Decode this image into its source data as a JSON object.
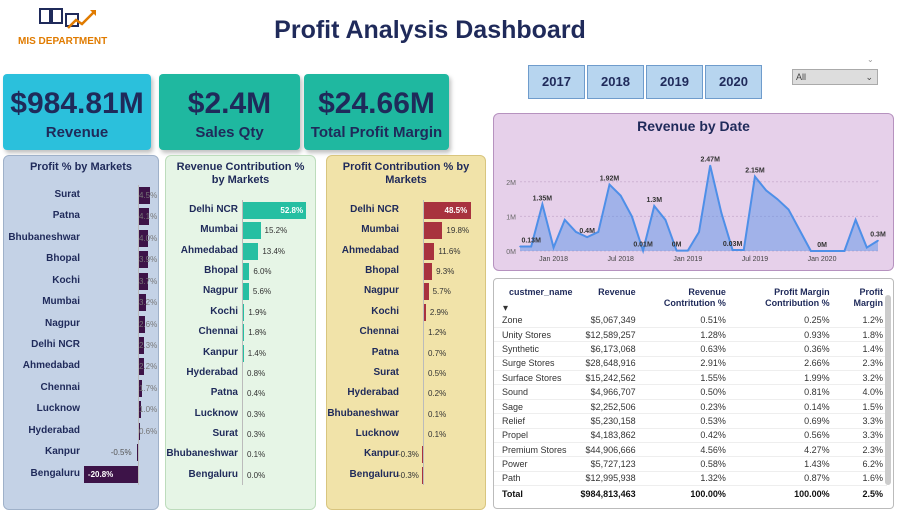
{
  "header": {
    "title": "Profit Analysis Dashboard",
    "logo_text": "MIS DEPARTMENT"
  },
  "kpis": [
    {
      "value": "$984.81M",
      "label": "Revenue"
    },
    {
      "value": "$2.4M",
      "label": "Sales Qty"
    },
    {
      "value": "$24.66M",
      "label": "Total Profit Margin"
    }
  ],
  "filters": {
    "years": [
      "2017",
      "2018",
      "2019",
      "2020"
    ],
    "dropdown_value": "All"
  },
  "colors": {
    "profit_bar": "#3d1348",
    "revenue_contrib_bar": "#26bfa2",
    "profit_contrib_bar": "#a8323e",
    "revenue_line": "#4e8fe8"
  },
  "chart_data": [
    {
      "type": "bar",
      "title": "Profit % by Markets",
      "categories": [
        "Surat",
        "Patna",
        "Bhubaneshwar",
        "Bhopal",
        "Kochi",
        "Mumbai",
        "Nagpur",
        "Delhi NCR",
        "Ahmedabad",
        "Chennai",
        "Lucknow",
        "Hyderabad",
        "Kanpur",
        "Bengaluru"
      ],
      "values": [
        4.5,
        4.1,
        4.0,
        3.9,
        3.7,
        3.2,
        2.6,
        2.3,
        2.2,
        1.7,
        1.0,
        0.6,
        -0.5,
        -20.8
      ],
      "labels": [
        "4.5%",
        "4.1%",
        "4.0%",
        "3.9%",
        "3.7%",
        "3.2%",
        "2.6%",
        "2.3%",
        "2.2%",
        "1.7%",
        "1.0%",
        "0.6%",
        "-0.5%",
        "-20.8%"
      ]
    },
    {
      "type": "bar",
      "title": "Revenue Contribution % by Markets",
      "categories": [
        "Delhi NCR",
        "Mumbai",
        "Ahmedabad",
        "Bhopal",
        "Nagpur",
        "Kochi",
        "Chennai",
        "Kanpur",
        "Hyderabad",
        "Patna",
        "Lucknow",
        "Surat",
        "Bhubaneshwar",
        "Bengaluru"
      ],
      "values": [
        52.8,
        15.2,
        13.4,
        6.0,
        5.6,
        1.9,
        1.8,
        1.4,
        0.8,
        0.4,
        0.3,
        0.3,
        0.1,
        0.0
      ],
      "labels": [
        "52.8%",
        "15.2%",
        "13.4%",
        "6.0%",
        "5.6%",
        "1.9%",
        "1.8%",
        "1.4%",
        "0.8%",
        "0.4%",
        "0.3%",
        "0.3%",
        "0.1%",
        "0.0%"
      ]
    },
    {
      "type": "bar",
      "title": "Profit Contribution % by Markets",
      "categories": [
        "Delhi NCR",
        "Mumbai",
        "Ahmedabad",
        "Bhopal",
        "Nagpur",
        "Kochi",
        "Chennai",
        "Patna",
        "Surat",
        "Hyderabad",
        "Bhubaneshwar",
        "Lucknow",
        "Kanpur",
        "Bengaluru"
      ],
      "values": [
        48.5,
        19.8,
        11.6,
        9.3,
        5.7,
        2.9,
        1.2,
        0.7,
        0.5,
        0.2,
        0.1,
        0.1,
        -0.3,
        -0.3
      ],
      "labels": [
        "48.5%",
        "19.8%",
        "11.6%",
        "9.3%",
        "5.7%",
        "2.9%",
        "1.2%",
        "0.7%",
        "0.5%",
        "0.2%",
        "0.1%",
        "0.1%",
        "-0.3%",
        "-0.3%"
      ]
    },
    {
      "type": "area",
      "title": "Revenue by Date",
      "x": [
        "2017-10",
        "2017-11",
        "2017-12",
        "2018-01",
        "2018-02",
        "2018-03",
        "2018-04",
        "2018-05",
        "2018-06",
        "2018-07",
        "2018-08",
        "2018-09",
        "2018-10",
        "2018-11",
        "2018-12",
        "2019-01",
        "2019-02",
        "2019-03",
        "2019-04",
        "2019-05",
        "2019-06",
        "2019-07",
        "2019-08",
        "2019-09",
        "2019-10",
        "2019-11",
        "2019-12",
        "2020-01",
        "2020-02",
        "2020-03",
        "2020-04",
        "2020-05",
        "2020-06"
      ],
      "y": [
        0.13,
        0.13,
        1.35,
        0.1,
        0.9,
        0.55,
        0.4,
        0.55,
        1.92,
        1.6,
        1.0,
        0.01,
        1.3,
        0.9,
        0.01,
        0.01,
        0.55,
        2.47,
        1.1,
        0.03,
        0.03,
        2.15,
        1.75,
        1.5,
        1.2,
        0.6,
        0.0,
        0.0,
        0.0,
        0.0,
        0.9,
        0.1,
        0.3
      ],
      "point_labels": [
        {
          "i": 1,
          "text": "0.13M"
        },
        {
          "i": 2,
          "text": "1.35M"
        },
        {
          "i": 6,
          "text": "0.4M"
        },
        {
          "i": 8,
          "text": "1.92M"
        },
        {
          "i": 11,
          "text": "0.01M"
        },
        {
          "i": 12,
          "text": "1.3M"
        },
        {
          "i": 14,
          "text": "0M"
        },
        {
          "i": 17,
          "text": "2.47M"
        },
        {
          "i": 19,
          "text": "0.03M"
        },
        {
          "i": 21,
          "text": "2.15M"
        },
        {
          "i": 27,
          "text": "0M"
        },
        {
          "i": 32,
          "text": "0.3M"
        }
      ],
      "yticks": [
        "0M",
        "1M",
        "2M"
      ],
      "xticks": [
        {
          "i": 3,
          "label": "Jan 2018"
        },
        {
          "i": 9,
          "label": "Jul 2018"
        },
        {
          "i": 15,
          "label": "Jan 2019"
        },
        {
          "i": 21,
          "label": "Jul 2019"
        },
        {
          "i": 27,
          "label": "Jan 2020"
        }
      ],
      "ylim": [
        0,
        2.6
      ]
    }
  ],
  "table": {
    "columns": [
      "custmer_name",
      "Revenue",
      "Revenue Contritution %",
      "Profit Margin Contribution %",
      "Profit Margin"
    ],
    "rows": [
      [
        "Zone",
        "$5,067,349",
        "0.51%",
        "0.25%",
        "1.2%"
      ],
      [
        "Unity Stores",
        "$12,589,257",
        "1.28%",
        "0.93%",
        "1.8%"
      ],
      [
        "Synthetic",
        "$6,173,068",
        "0.63%",
        "0.36%",
        "1.4%"
      ],
      [
        "Surge Stores",
        "$28,648,916",
        "2.91%",
        "2.66%",
        "2.3%"
      ],
      [
        "Surface Stores",
        "$15,242,562",
        "1.55%",
        "1.99%",
        "3.2%"
      ],
      [
        "Sound",
        "$4,966,707",
        "0.50%",
        "0.81%",
        "4.0%"
      ],
      [
        "Sage",
        "$2,252,506",
        "0.23%",
        "0.14%",
        "1.5%"
      ],
      [
        "Relief",
        "$5,230,158",
        "0.53%",
        "0.69%",
        "3.3%"
      ],
      [
        "Propel",
        "$4,183,862",
        "0.42%",
        "0.56%",
        "3.3%"
      ],
      [
        "Premium Stores",
        "$44,906,666",
        "4.56%",
        "4.27%",
        "2.3%"
      ],
      [
        "Power",
        "$5,727,123",
        "0.58%",
        "1.43%",
        "6.2%"
      ],
      [
        "Path",
        "$12,995,938",
        "1.32%",
        "0.87%",
        "1.6%"
      ]
    ],
    "total": [
      "Total",
      "$984,813,463",
      "100.00%",
      "100.00%",
      "2.5%"
    ]
  }
}
